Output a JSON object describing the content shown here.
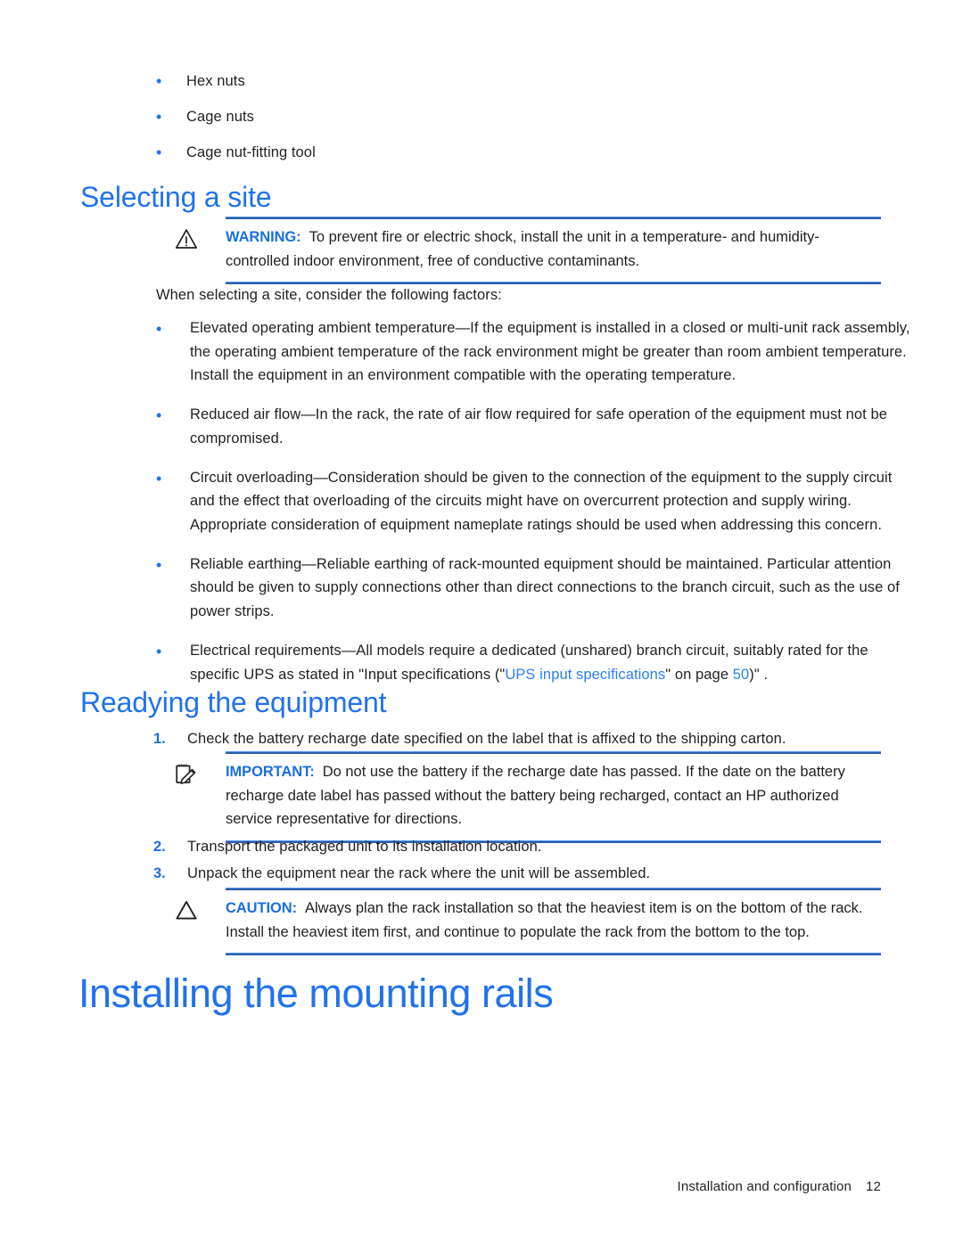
{
  "page": {
    "footer_text": "Installation and configuration",
    "footer_page_number": "12"
  },
  "parts_list": {
    "items": [
      {
        "bullet": "•",
        "text": "Hex nuts"
      },
      {
        "bullet": "•",
        "text": "Cage nuts"
      },
      {
        "bullet": "•",
        "text": "Cage nut-fitting tool"
      }
    ]
  },
  "selecting_a_site": {
    "heading": "Selecting a site",
    "warning": {
      "icon": "warning-triangle-icon",
      "label": "WARNING:",
      "text": "To prevent fire or electric shock, install the unit in a temperature- and humidity-controlled indoor environment, free of conductive contaminants."
    },
    "intro": "When selecting a site, consider the following factors:",
    "factors": [
      {
        "bullet": "•",
        "text": "Elevated operating ambient temperature—If the equipment is installed in a closed or multi-unit rack assembly, the operating ambient temperature of the rack environment might be greater than room ambient temperature. Install the equipment in an environment compatible with the operating temperature."
      },
      {
        "bullet": "•",
        "text": "Reduced air flow—In the rack, the rate of air flow required for safe operation of the equipment must not be compromised."
      },
      {
        "bullet": "•",
        "text": "Circuit overloading—Consideration should be given to the connection of the equipment to the supply circuit and the effect that overloading of the circuits might have on overcurrent protection and supply wiring. Appropriate consideration of equipment nameplate ratings should be used when addressing this concern."
      },
      {
        "bullet": "•",
        "text": "Reliable earthing—Reliable earthing of rack-mounted equipment should be maintained. Particular attention should be given to supply connections other than direct connections to the branch circuit, such as the use of power strips."
      }
    ],
    "electrical_requirement": {
      "bullet": "•",
      "text_before": "Electrical requirements—All models require a dedicated (unshared) branch circuit, suitably rated for the specific UPS as stated in \"Input specifications (\"",
      "link_text": "UPS input specifications",
      "text_middle": "\" on page ",
      "link_page": "50",
      "text_after": ")\" ."
    }
  },
  "readying_the_equipment": {
    "heading": "Readying the equipment",
    "steps": [
      {
        "number": "1.",
        "text": "Check the battery recharge date specified on the label that is affixed to the shipping carton."
      },
      {
        "number": "2.",
        "text": "Transport the packaged unit to its installation location."
      },
      {
        "number": "3.",
        "text": "Unpack the equipment near the rack where the unit will be assembled."
      }
    ],
    "important": {
      "icon": "note-pencil-icon",
      "label": "IMPORTANT:",
      "text": "Do not use the battery if the recharge date has passed. If the date on the battery recharge date label has passed without the battery being recharged, contact an HP authorized service representative for directions."
    },
    "caution": {
      "icon": "caution-triangle-icon",
      "label": "CAUTION:",
      "text": "Always plan the rack installation so that the heaviest item is on the bottom of the rack. Install the heaviest item first, and continue to populate the rack from the bottom to the top."
    }
  },
  "installing_the_mounting_rails": {
    "heading": "Installing the mounting rails"
  },
  "colors": {
    "heading_blue": "#2172ec",
    "label_blue": "#1b6fe0",
    "link_blue": "#2a80f0",
    "rule_blue_light": "#4a90f0",
    "rule_blue_dark": "#2f5fa8",
    "body_ink": "#231f20"
  }
}
